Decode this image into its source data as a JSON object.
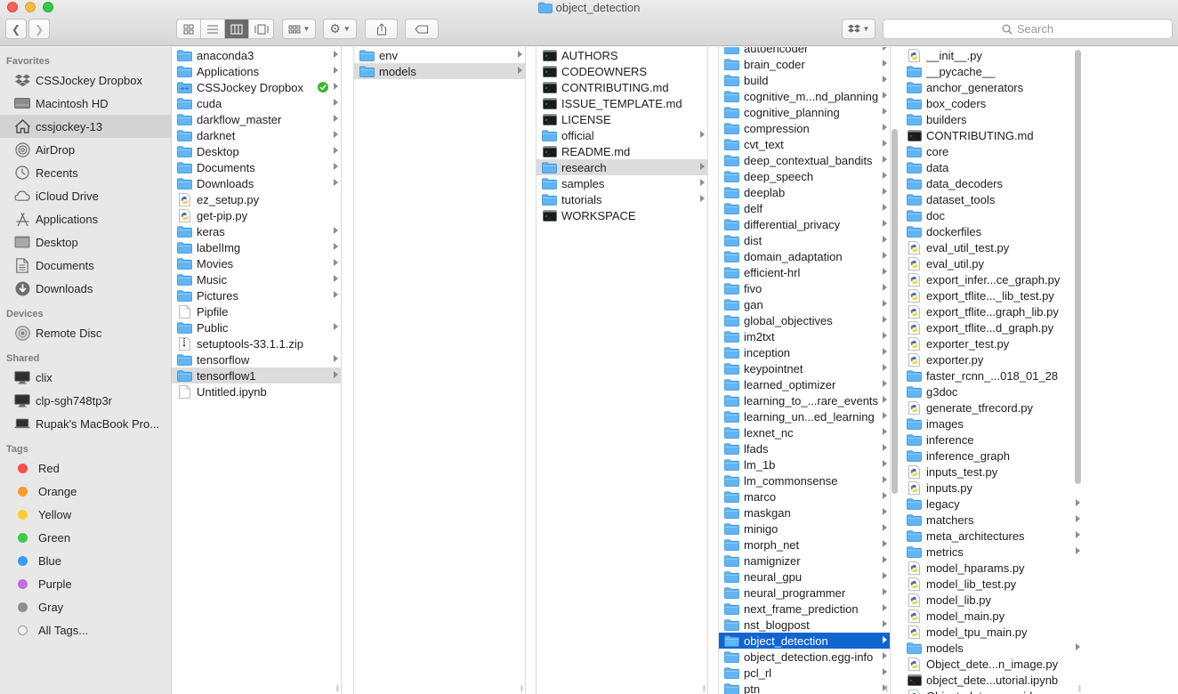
{
  "window": {
    "title": "object_detection"
  },
  "toolbar": {
    "search_placeholder": "Search"
  },
  "sidebar": {
    "favorites_heading": "Favorites",
    "favorites": [
      {
        "label": "CSSJockey Dropbox",
        "icon": "dropbox-icon"
      },
      {
        "label": "Macintosh HD",
        "icon": "hard-drive-icon"
      },
      {
        "label": "cssjockey-13",
        "icon": "home-icon",
        "selected": true
      },
      {
        "label": "AirDrop",
        "icon": "airdrop-icon"
      },
      {
        "label": "Recents",
        "icon": "clock-icon"
      },
      {
        "label": "iCloud Drive",
        "icon": "cloud-icon"
      },
      {
        "label": "Applications",
        "icon": "applications-icon"
      },
      {
        "label": "Desktop",
        "icon": "desktop-icon"
      },
      {
        "label": "Documents",
        "icon": "document-icon"
      },
      {
        "label": "Downloads",
        "icon": "download-icon"
      }
    ],
    "devices_heading": "Devices",
    "devices": [
      {
        "label": "Remote Disc",
        "icon": "disc-icon"
      }
    ],
    "shared_heading": "Shared",
    "shared": [
      {
        "label": "clix",
        "icon": "monitor-icon"
      },
      {
        "label": "clp-sgh748tp3r",
        "icon": "monitor-icon"
      },
      {
        "label": "Rupak's MacBook Pro...",
        "icon": "laptop-icon"
      }
    ],
    "tags_heading": "Tags",
    "tags": [
      {
        "label": "Red",
        "color": "#fc4f4b"
      },
      {
        "label": "Orange",
        "color": "#fd9a2c"
      },
      {
        "label": "Yellow",
        "color": "#fecc2f"
      },
      {
        "label": "Green",
        "color": "#3fca4a"
      },
      {
        "label": "Blue",
        "color": "#3b9bf6"
      },
      {
        "label": "Purple",
        "color": "#c56ce0"
      },
      {
        "label": "Gray",
        "color": "#8e8e93"
      },
      {
        "label": "All Tags...",
        "color": ""
      }
    ]
  },
  "columns": [
    {
      "items": [
        {
          "name": "anaconda3",
          "type": "folder",
          "arrow": true
        },
        {
          "name": "Applications",
          "type": "folder",
          "arrow": true
        },
        {
          "name": "CSSJockey Dropbox",
          "type": "folder-dropbox",
          "arrow": true,
          "synced": true
        },
        {
          "name": "cuda",
          "type": "folder",
          "arrow": true
        },
        {
          "name": "darkflow_master",
          "type": "folder",
          "arrow": true
        },
        {
          "name": "darknet",
          "type": "folder",
          "arrow": true
        },
        {
          "name": "Desktop",
          "type": "folder",
          "arrow": true
        },
        {
          "name": "Documents",
          "type": "folder",
          "arrow": true
        },
        {
          "name": "Downloads",
          "type": "folder",
          "arrow": true
        },
        {
          "name": "ez_setup.py",
          "type": "python",
          "arrow": false
        },
        {
          "name": "get-pip.py",
          "type": "python",
          "arrow": false
        },
        {
          "name": "keras",
          "type": "folder",
          "arrow": true
        },
        {
          "name": "labelImg",
          "type": "folder",
          "arrow": true
        },
        {
          "name": "Movies",
          "type": "folder",
          "arrow": true
        },
        {
          "name": "Music",
          "type": "folder",
          "arrow": true
        },
        {
          "name": "Pictures",
          "type": "folder",
          "arrow": true
        },
        {
          "name": "Pipfile",
          "type": "file",
          "arrow": false
        },
        {
          "name": "Public",
          "type": "folder",
          "arrow": true
        },
        {
          "name": "setuptools-33.1.1.zip",
          "type": "zip",
          "arrow": false
        },
        {
          "name": "tensorflow",
          "type": "folder",
          "arrow": true
        },
        {
          "name": "tensorflow1",
          "type": "folder",
          "arrow": true,
          "state": "hl"
        },
        {
          "name": "Untitled.ipynb",
          "type": "file",
          "arrow": false
        }
      ]
    },
    {
      "items": [
        {
          "name": "env",
          "type": "folder",
          "arrow": true
        },
        {
          "name": "models",
          "type": "folder",
          "arrow": true,
          "state": "hl"
        }
      ]
    },
    {
      "items": [
        {
          "name": "AUTHORS",
          "type": "exec",
          "arrow": false
        },
        {
          "name": "CODEOWNERS",
          "type": "exec",
          "arrow": false
        },
        {
          "name": "CONTRIBUTING.md",
          "type": "exec",
          "arrow": false
        },
        {
          "name": "ISSUE_TEMPLATE.md",
          "type": "exec",
          "arrow": false
        },
        {
          "name": "LICENSE",
          "type": "exec",
          "arrow": false
        },
        {
          "name": "official",
          "type": "folder",
          "arrow": true
        },
        {
          "name": "README.md",
          "type": "exec",
          "arrow": false
        },
        {
          "name": "research",
          "type": "folder",
          "arrow": true,
          "state": "hl"
        },
        {
          "name": "samples",
          "type": "folder",
          "arrow": true
        },
        {
          "name": "tutorials",
          "type": "folder",
          "arrow": true
        },
        {
          "name": "WORKSPACE",
          "type": "exec",
          "arrow": false
        }
      ]
    },
    {
      "items": [
        {
          "name": "autoencoder",
          "type": "folder",
          "arrow": true
        },
        {
          "name": "brain_coder",
          "type": "folder",
          "arrow": true
        },
        {
          "name": "build",
          "type": "folder",
          "arrow": true
        },
        {
          "name": "cognitive_m...nd_planning",
          "type": "folder",
          "arrow": true
        },
        {
          "name": "cognitive_planning",
          "type": "folder",
          "arrow": true
        },
        {
          "name": "compression",
          "type": "folder",
          "arrow": true
        },
        {
          "name": "cvt_text",
          "type": "folder",
          "arrow": true
        },
        {
          "name": "deep_contextual_bandits",
          "type": "folder",
          "arrow": true
        },
        {
          "name": "deep_speech",
          "type": "folder",
          "arrow": true
        },
        {
          "name": "deeplab",
          "type": "folder",
          "arrow": true
        },
        {
          "name": "delf",
          "type": "folder",
          "arrow": true
        },
        {
          "name": "differential_privacy",
          "type": "folder",
          "arrow": true
        },
        {
          "name": "dist",
          "type": "folder",
          "arrow": true
        },
        {
          "name": "domain_adaptation",
          "type": "folder",
          "arrow": true
        },
        {
          "name": "efficient-hrl",
          "type": "folder",
          "arrow": true
        },
        {
          "name": "fivo",
          "type": "folder",
          "arrow": true
        },
        {
          "name": "gan",
          "type": "folder",
          "arrow": true
        },
        {
          "name": "global_objectives",
          "type": "folder",
          "arrow": true
        },
        {
          "name": "im2txt",
          "type": "folder",
          "arrow": true
        },
        {
          "name": "inception",
          "type": "folder",
          "arrow": true
        },
        {
          "name": "keypointnet",
          "type": "folder",
          "arrow": true
        },
        {
          "name": "learned_optimizer",
          "type": "folder",
          "arrow": true
        },
        {
          "name": "learning_to_...rare_events",
          "type": "folder",
          "arrow": true
        },
        {
          "name": "learning_un...ed_learning",
          "type": "folder",
          "arrow": true
        },
        {
          "name": "lexnet_nc",
          "type": "folder",
          "arrow": true
        },
        {
          "name": "lfads",
          "type": "folder",
          "arrow": true
        },
        {
          "name": "lm_1b",
          "type": "folder",
          "arrow": true
        },
        {
          "name": "lm_commonsense",
          "type": "folder",
          "arrow": true
        },
        {
          "name": "marco",
          "type": "folder",
          "arrow": true
        },
        {
          "name": "maskgan",
          "type": "folder",
          "arrow": true
        },
        {
          "name": "minigo",
          "type": "folder",
          "arrow": true
        },
        {
          "name": "morph_net",
          "type": "folder",
          "arrow": true
        },
        {
          "name": "namignizer",
          "type": "folder",
          "arrow": true
        },
        {
          "name": "neural_gpu",
          "type": "folder",
          "arrow": true
        },
        {
          "name": "neural_programmer",
          "type": "folder",
          "arrow": true
        },
        {
          "name": "next_frame_prediction",
          "type": "folder",
          "arrow": true
        },
        {
          "name": "nst_blogpost",
          "type": "folder",
          "arrow": true
        },
        {
          "name": "object_detection",
          "type": "folder",
          "arrow": true,
          "state": "active"
        },
        {
          "name": "object_detection.egg-info",
          "type": "folder",
          "arrow": true
        },
        {
          "name": "pcl_rl",
          "type": "folder",
          "arrow": true
        },
        {
          "name": "ptn",
          "type": "folder",
          "arrow": true
        }
      ]
    },
    {
      "items": [
        {
          "name": "__init__.py",
          "type": "python",
          "arrow": false
        },
        {
          "name": "__pycache__",
          "type": "folder",
          "arrow": true
        },
        {
          "name": "anchor_generators",
          "type": "folder",
          "arrow": true
        },
        {
          "name": "box_coders",
          "type": "folder",
          "arrow": true
        },
        {
          "name": "builders",
          "type": "folder",
          "arrow": true
        },
        {
          "name": "CONTRIBUTING.md",
          "type": "exec",
          "arrow": false
        },
        {
          "name": "core",
          "type": "folder",
          "arrow": true
        },
        {
          "name": "data",
          "type": "folder",
          "arrow": true
        },
        {
          "name": "data_decoders",
          "type": "folder",
          "arrow": true
        },
        {
          "name": "dataset_tools",
          "type": "folder",
          "arrow": true
        },
        {
          "name": "doc",
          "type": "folder",
          "arrow": true
        },
        {
          "name": "dockerfiles",
          "type": "folder",
          "arrow": true
        },
        {
          "name": "eval_util_test.py",
          "type": "python",
          "arrow": false
        },
        {
          "name": "eval_util.py",
          "type": "python",
          "arrow": false
        },
        {
          "name": "export_infer...ce_graph.py",
          "type": "python",
          "arrow": false
        },
        {
          "name": "export_tflite..._lib_test.py",
          "type": "python",
          "arrow": false
        },
        {
          "name": "export_tflite...graph_lib.py",
          "type": "python",
          "arrow": false
        },
        {
          "name": "export_tflite...d_graph.py",
          "type": "python",
          "arrow": false
        },
        {
          "name": "exporter_test.py",
          "type": "python",
          "arrow": false
        },
        {
          "name": "exporter.py",
          "type": "python",
          "arrow": false
        },
        {
          "name": "faster_rcnn_...018_01_28",
          "type": "folder",
          "arrow": true
        },
        {
          "name": "g3doc",
          "type": "folder",
          "arrow": true
        },
        {
          "name": "generate_tfrecord.py",
          "type": "python",
          "arrow": false
        },
        {
          "name": "images",
          "type": "folder",
          "arrow": true
        },
        {
          "name": "inference",
          "type": "folder",
          "arrow": true
        },
        {
          "name": "inference_graph",
          "type": "folder",
          "arrow": true
        },
        {
          "name": "inputs_test.py",
          "type": "python",
          "arrow": false
        },
        {
          "name": "inputs.py",
          "type": "python",
          "arrow": false
        },
        {
          "name": "legacy",
          "type": "folder",
          "arrow": true
        },
        {
          "name": "matchers",
          "type": "folder",
          "arrow": true
        },
        {
          "name": "meta_architectures",
          "type": "folder",
          "arrow": true
        },
        {
          "name": "metrics",
          "type": "folder",
          "arrow": true
        },
        {
          "name": "model_hparams.py",
          "type": "python",
          "arrow": false
        },
        {
          "name": "model_lib_test.py",
          "type": "python",
          "arrow": false
        },
        {
          "name": "model_lib.py",
          "type": "python",
          "arrow": false
        },
        {
          "name": "model_main.py",
          "type": "python",
          "arrow": false
        },
        {
          "name": "model_tpu_main.py",
          "type": "python",
          "arrow": false
        },
        {
          "name": "models",
          "type": "folder",
          "arrow": true
        },
        {
          "name": "Object_dete...n_image.py",
          "type": "python",
          "arrow": false
        },
        {
          "name": "object_dete...utorial.ipynb",
          "type": "exec",
          "arrow": false
        },
        {
          "name": "Object_dete...on_video.py",
          "type": "python",
          "arrow": false
        }
      ]
    }
  ]
}
